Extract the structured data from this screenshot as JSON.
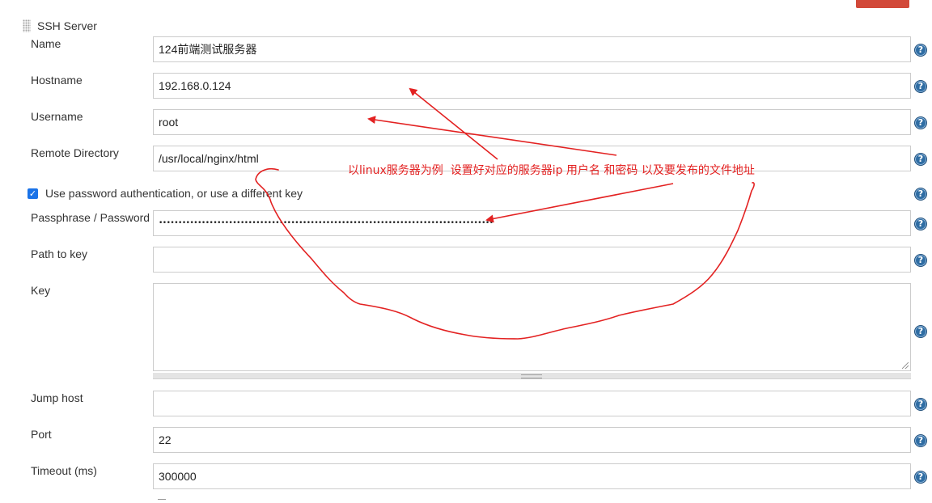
{
  "section": {
    "title": "SSH Server"
  },
  "fields": {
    "name": {
      "label": "Name",
      "value": "124前端测试服务器"
    },
    "hostname": {
      "label": "Hostname",
      "value": " 192.168.0.124"
    },
    "username": {
      "label": "Username",
      "value": "root"
    },
    "remote_directory": {
      "label": "Remote Directory",
      "value": "/usr/local/nginx/html"
    },
    "use_password": {
      "label": "Use password authentication, or use a different key",
      "checked": true
    },
    "passphrase": {
      "label": "Passphrase / Password",
      "value": "••••••••••••••••••••••••••••••••••••••••••••••••••••••••••••••••••••••••••••••••••••••"
    },
    "path_to_key": {
      "label": "Path to key",
      "value": ""
    },
    "key": {
      "label": "Key",
      "value": ""
    },
    "jump_host": {
      "label": "Jump host",
      "value": ""
    },
    "port": {
      "label": "Port",
      "value": "22"
    },
    "timeout": {
      "label": "Timeout (ms)",
      "value": "300000"
    }
  },
  "help": {
    "glyph": "?"
  },
  "annotation": {
    "text": "以linux服务器为例  设置好对应的服务器ip 用户名 和密码 以及要发布的文件地址",
    "color": "#e32222"
  },
  "colors": {
    "accent_red": "#d24939",
    "help_blue": "#2f6da3",
    "checkbox_blue": "#1a73e8"
  }
}
